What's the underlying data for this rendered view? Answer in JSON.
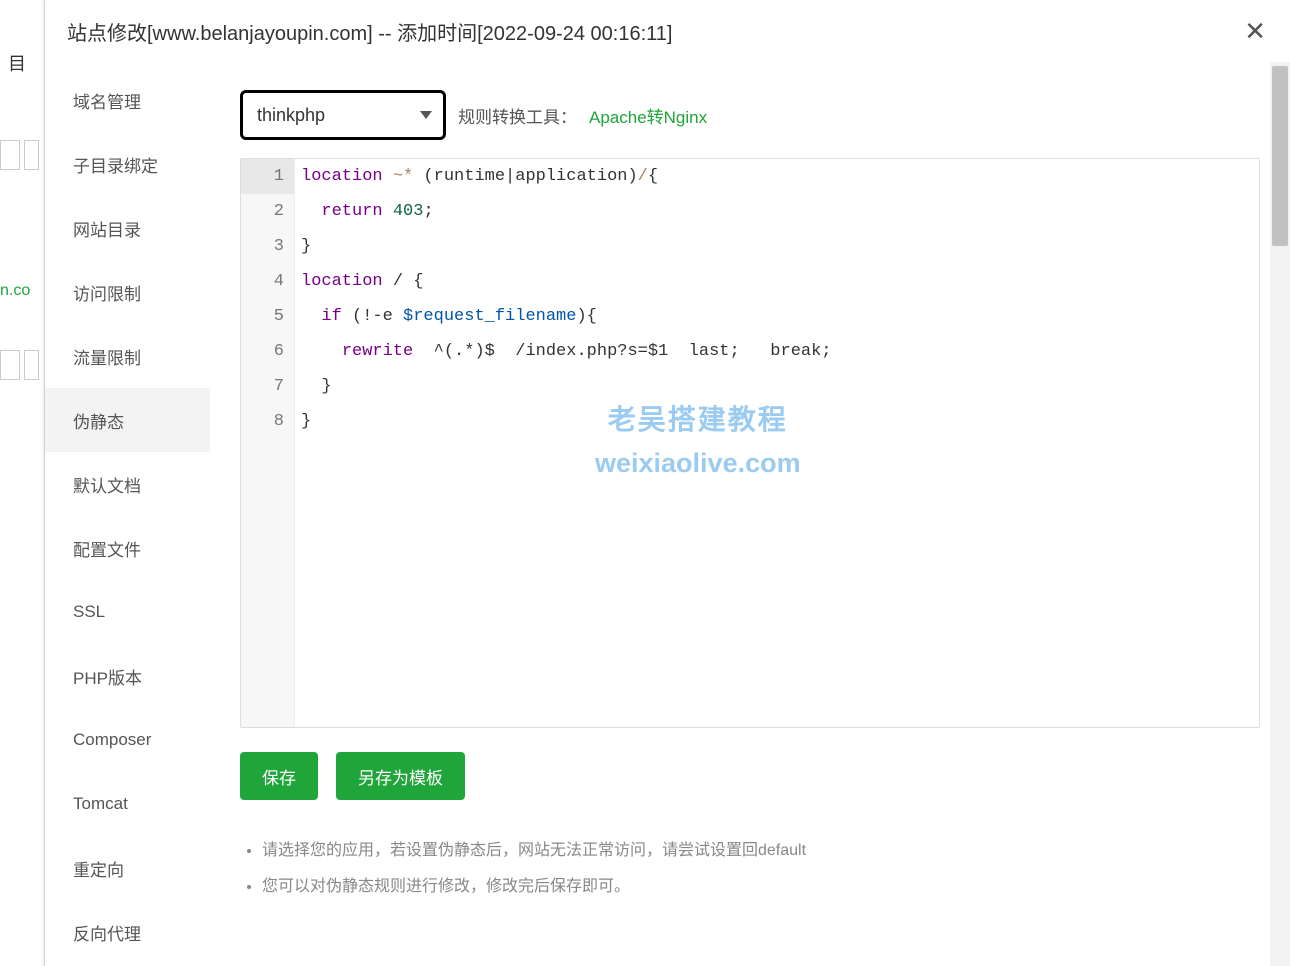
{
  "backdrop": {
    "partial_text": "目",
    "partial_green": "n.co"
  },
  "dialog": {
    "title": "站点修改[www.belanjayoupin.com] -- 添加时间[2022-09-24 00:16:11]"
  },
  "sidebar": {
    "items": [
      {
        "label": "域名管理",
        "key": "domain"
      },
      {
        "label": "子目录绑定",
        "key": "subdir"
      },
      {
        "label": "网站目录",
        "key": "webdir"
      },
      {
        "label": "访问限制",
        "key": "access-limit"
      },
      {
        "label": "流量限制",
        "key": "traffic-limit"
      },
      {
        "label": "伪静态",
        "key": "rewrite",
        "active": true
      },
      {
        "label": "默认文档",
        "key": "default-doc"
      },
      {
        "label": "配置文件",
        "key": "config"
      },
      {
        "label": "SSL",
        "key": "ssl"
      },
      {
        "label": "PHP版本",
        "key": "php-ver"
      },
      {
        "label": "Composer",
        "key": "composer"
      },
      {
        "label": "Tomcat",
        "key": "tomcat"
      },
      {
        "label": "重定向",
        "key": "redirect"
      },
      {
        "label": "反向代理",
        "key": "reverse-proxy"
      }
    ]
  },
  "toolbar": {
    "select_value": "thinkphp",
    "convert_label": "规则转换工具：",
    "convert_link": "Apache转Nginx"
  },
  "code": {
    "lines": [
      {
        "n": 1,
        "html": "<span class='tok-kw'>location</span> <span class='tok-op'>~*</span> (runtime|application)<span class='tok-op'>/</span>{"
      },
      {
        "n": 2,
        "html": "  <span class='tok-kw'>return</span> <span class='tok-num'>403</span>;"
      },
      {
        "n": 3,
        "html": "}"
      },
      {
        "n": 4,
        "html": "<span class='tok-kw'>location</span> / {"
      },
      {
        "n": 5,
        "html": "  <span class='tok-kw'>if</span> (!-e <span class='tok-var'>$request_filename</span>){"
      },
      {
        "n": 6,
        "html": "    <span class='tok-kw'>rewrite</span>  ^(.*)$  /index.php?s=$1  last;   break;"
      },
      {
        "n": 7,
        "html": "  }"
      },
      {
        "n": 8,
        "html": "}"
      }
    ]
  },
  "buttons": {
    "save": "保存",
    "save_as_tpl": "另存为模板"
  },
  "tips": {
    "t1": "请选择您的应用，若设置伪静态后，网站无法正常访问，请尝试设置回default",
    "t2": "您可以对伪静态规则进行修改，修改完后保存即可。"
  },
  "watermark": {
    "line1": "老吴搭建教程",
    "line2": "weixiaolive.com"
  }
}
